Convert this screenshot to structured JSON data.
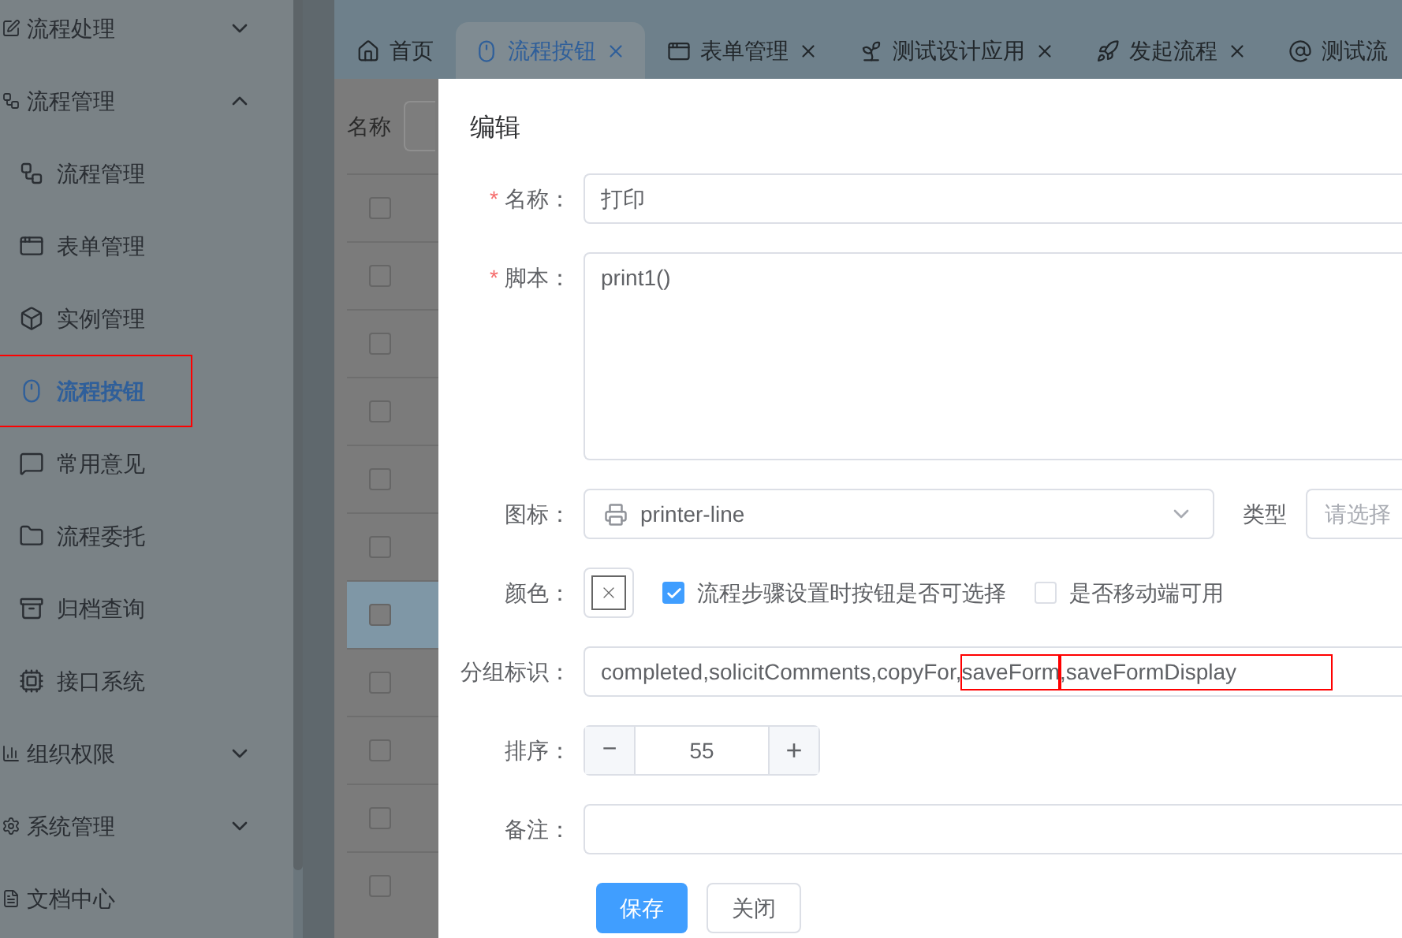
{
  "sidebar": {
    "items": [
      {
        "label": "流程处理",
        "kind": "group",
        "expanded": false
      },
      {
        "label": "流程管理",
        "kind": "group",
        "expanded": true
      },
      {
        "label": "流程管理",
        "kind": "child",
        "selected": false,
        "marked": false
      },
      {
        "label": "表单管理",
        "kind": "child",
        "selected": false,
        "marked": false
      },
      {
        "label": "实例管理",
        "kind": "child",
        "selected": false,
        "marked": false
      },
      {
        "label": "流程按钮",
        "kind": "child",
        "selected": true,
        "marked": true
      },
      {
        "label": "常用意见",
        "kind": "child",
        "selected": false,
        "marked": false
      },
      {
        "label": "流程委托",
        "kind": "child",
        "selected": false,
        "marked": false
      },
      {
        "label": "归档查询",
        "kind": "child",
        "selected": false,
        "marked": false
      },
      {
        "label": "接口系统",
        "kind": "child",
        "selected": false,
        "marked": false
      },
      {
        "label": "组织权限",
        "kind": "group",
        "expanded": false
      },
      {
        "label": "系统管理",
        "kind": "group",
        "expanded": false
      },
      {
        "label": "文档中心",
        "kind": "link"
      }
    ]
  },
  "tabs": [
    {
      "label": "首页",
      "selected": false,
      "closable": false
    },
    {
      "label": "流程按钮",
      "selected": true,
      "closable": true
    },
    {
      "label": "表单管理",
      "selected": false,
      "closable": true
    },
    {
      "label": "测试设计应用",
      "selected": false,
      "closable": true
    },
    {
      "label": "发起流程",
      "selected": false,
      "closable": true
    },
    {
      "label": "测试流",
      "selected": false,
      "closable": false
    }
  ],
  "filter": {
    "label": "名称"
  },
  "table": {
    "rows": [
      {
        "selected": false
      },
      {
        "selected": false
      },
      {
        "selected": false
      },
      {
        "selected": false
      },
      {
        "selected": false
      },
      {
        "selected": false
      },
      {
        "selected": true
      },
      {
        "selected": false
      },
      {
        "selected": false
      },
      {
        "selected": false
      },
      {
        "selected": false
      }
    ]
  },
  "dialog": {
    "title": "编辑",
    "name": {
      "label": "名称：",
      "required_mark": "*",
      "value": "打印"
    },
    "script": {
      "label": "脚本：",
      "required_mark": "*",
      "value": "print1()"
    },
    "icon": {
      "label": "图标：",
      "value": "printer-line"
    },
    "type": {
      "label": "类型",
      "placeholder": "请选择"
    },
    "color": {
      "label": "颜色："
    },
    "checkboxes": [
      {
        "label": "流程步骤设置时按钮是否可选择",
        "checked": true
      },
      {
        "label": "是否移动端可用",
        "checked": false
      }
    ],
    "group": {
      "label": "分组标识：",
      "segments": [
        {
          "text": "completed,solicitComments,copyFor,",
          "marked": false
        },
        {
          "text": "saveForm",
          "marked": true
        },
        {
          "text": ",saveFormDisplay",
          "marked": true
        }
      ]
    },
    "order": {
      "label": "排序：",
      "minus": "−",
      "value": "55",
      "plus": "+"
    },
    "remark": {
      "label": "备注："
    },
    "buttons": [
      {
        "label": "保存",
        "kind": "primary"
      },
      {
        "label": "关闭",
        "kind": "default"
      }
    ]
  }
}
